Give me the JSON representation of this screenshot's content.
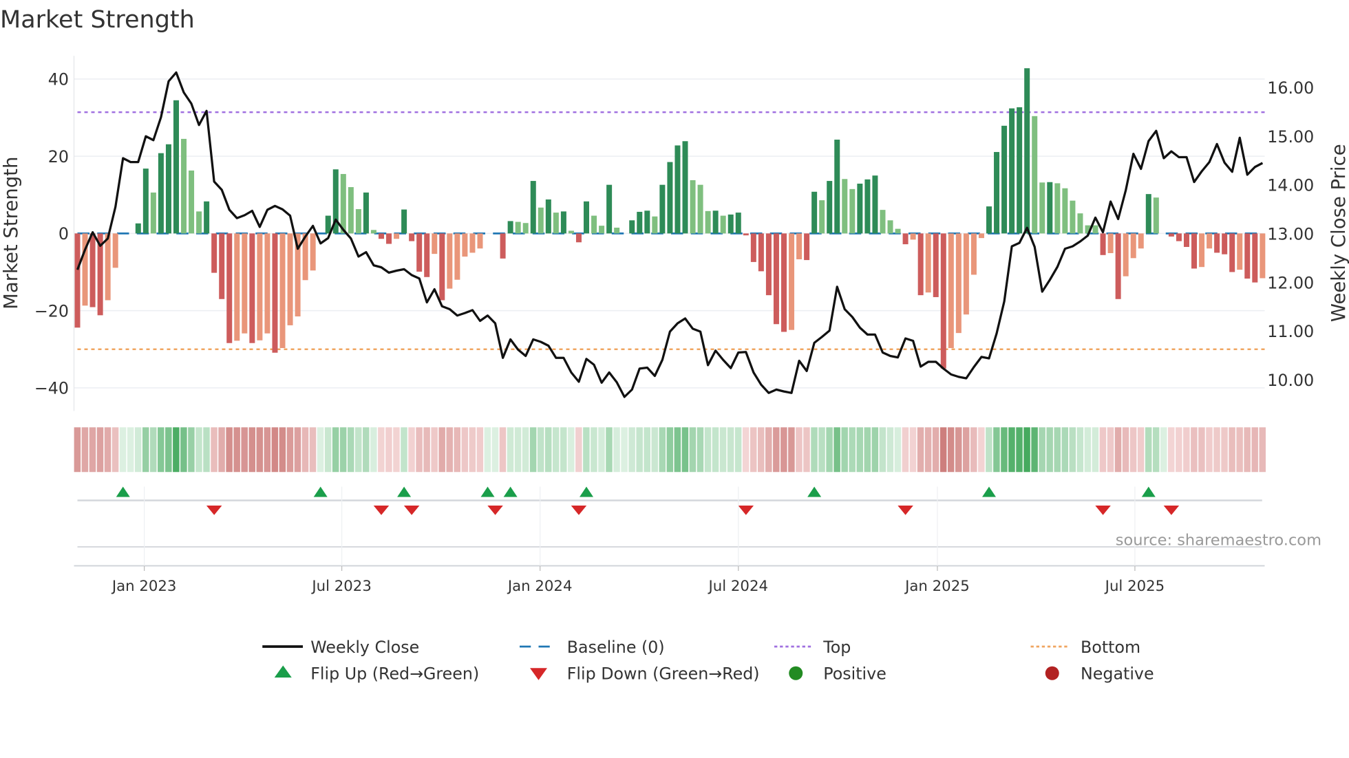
{
  "chart_data": {
    "type": "bar",
    "title": "Market Strength",
    "ylabel": "Market Strength",
    "ylabel_right": "Weekly Close Price",
    "ylim": [
      -46,
      46
    ],
    "ylim_right": [
      9.36,
      16.65
    ],
    "yticks": [
      40,
      20,
      0,
      -20,
      -40
    ],
    "yticks_right": [
      "16.00",
      "15.00",
      "14.00",
      "13.00",
      "12.00",
      "11.00",
      "10.00"
    ],
    "grid": true,
    "top_level": 31.4,
    "bottom_level": -30,
    "baseline": 0,
    "x_unit": "week index (1 = first week shown, ~early Nov 2022)",
    "x_ticks": [
      {
        "label": "Jan 2023",
        "week": 9.8
      },
      {
        "label": "Jul 2023",
        "week": 35.8
      },
      {
        "label": "Jan 2024",
        "week": 61.9
      },
      {
        "label": "Jul 2024",
        "week": 88.0
      },
      {
        "label": "Jan 2025",
        "week": 114.2
      },
      {
        "label": "Jul 2025",
        "week": 140.2
      }
    ],
    "strength": [
      -24.4,
      -18.7,
      -19.1,
      -21.2,
      -17.3,
      -8.9,
      0,
      0,
      2.6,
      16.8,
      10.6,
      20.8,
      23.1,
      34.5,
      24.5,
      16.3,
      5.7,
      8.3,
      -10.2,
      -17,
      -28.4,
      -27.8,
      -25.9,
      -28.4,
      -27.7,
      -25.9,
      -30.9,
      -29.7,
      -23.8,
      -21.5,
      -12.1,
      -9.6,
      0,
      4.6,
      16.6,
      15.4,
      12,
      6.3,
      10.6,
      0.9,
      -1.4,
      -2.7,
      -1.4,
      6.2,
      -2,
      -9.9,
      -11.3,
      -5.3,
      -17.3,
      -14.3,
      -12,
      -6,
      -5,
      -3.9,
      0,
      0,
      -6.5,
      3.2,
      3,
      2.7,
      13.6,
      6.7,
      8.8,
      5.4,
      5.7,
      0.7,
      -2.3,
      8.3,
      4.6,
      2,
      12.6,
      1.5,
      0,
      3.4,
      5.6,
      5.9,
      4.4,
      12.6,
      18.5,
      22.8,
      23.9,
      13.8,
      12.6,
      5.8,
      5.9,
      4.6,
      4.9,
      5.4,
      -0.5,
      -7.4,
      -9.8,
      -16,
      -23.5,
      -25.5,
      -25,
      -6.7,
      -6.9,
      10.8,
      8.6,
      13.6,
      24.3,
      14.1,
      11.5,
      12.9,
      14,
      15,
      6.1,
      3.4,
      1.2,
      -2.8,
      -1.6,
      -16,
      -15.3,
      -16.5,
      -35,
      -29.7,
      -25.8,
      -21,
      -10.7,
      -1.2,
      7,
      21.1,
      27.9,
      32.4,
      32.7,
      42.8,
      30.4,
      13.2,
      13.3,
      13,
      11.7,
      8.5,
      5.2,
      2.1,
      2.1,
      -5.6,
      -5.1,
      -17,
      -11.1,
      -6.4,
      -3.9,
      10.2,
      9.3,
      0,
      -0.8,
      -2,
      -3.5,
      -9.1,
      -8.7,
      -3.9,
      -5,
      -5.4,
      -10,
      -9.4,
      -11.7,
      -12.7,
      -11.6
    ],
    "strength_strong": [
      1,
      0,
      1,
      1,
      0,
      0,
      0,
      0,
      1,
      1,
      0,
      1,
      1,
      1,
      0,
      0,
      0,
      1,
      1,
      1,
      1,
      0,
      0,
      1,
      0,
      0,
      1,
      0,
      0,
      0,
      0,
      0,
      0,
      1,
      1,
      0,
      0,
      0,
      1,
      0,
      1,
      1,
      0,
      1,
      1,
      1,
      1,
      0,
      1,
      0,
      0,
      0,
      0,
      0,
      0,
      0,
      1,
      1,
      0,
      0,
      1,
      0,
      1,
      0,
      1,
      0,
      1,
      1,
      0,
      0,
      1,
      0,
      0,
      1,
      1,
      1,
      0,
      1,
      1,
      1,
      1,
      0,
      0,
      0,
      1,
      0,
      1,
      1,
      1,
      1,
      1,
      1,
      1,
      1,
      0,
      0,
      1,
      1,
      0,
      1,
      1,
      0,
      0,
      1,
      1,
      1,
      0,
      0,
      0,
      1,
      0,
      1,
      0,
      1,
      1,
      0,
      0,
      0,
      0,
      0,
      1,
      1,
      1,
      1,
      1,
      1,
      0,
      0,
      1,
      0,
      0,
      0,
      0,
      0,
      0,
      1,
      0,
      1,
      0,
      0,
      0,
      1,
      0,
      0,
      1,
      1,
      1,
      1,
      0,
      0,
      1,
      1,
      1,
      0,
      1,
      1,
      0
    ],
    "close": [
      12.26,
      12.67,
      13.03,
      12.75,
      12.9,
      13.55,
      14.55,
      14.47,
      14.47,
      15.0,
      14.92,
      15.39,
      16.13,
      16.31,
      15.9,
      15.67,
      15.23,
      15.52,
      14.07,
      13.9,
      13.49,
      13.32,
      13.38,
      13.47,
      13.14,
      13.49,
      13.57,
      13.5,
      13.37,
      12.69,
      12.94,
      13.16,
      12.8,
      12.91,
      13.29,
      13.08,
      12.9,
      12.53,
      12.62,
      12.35,
      12.31,
      12.2,
      12.24,
      12.27,
      12.15,
      12.08,
      11.59,
      11.86,
      11.51,
      11.45,
      11.32,
      11.37,
      11.43,
      11.21,
      11.32,
      11.16,
      10.45,
      10.83,
      10.62,
      10.49,
      10.83,
      10.78,
      10.7,
      10.45,
      10.45,
      10.15,
      9.96,
      10.43,
      10.31,
      9.94,
      10.15,
      9.95,
      9.65,
      9.8,
      10.23,
      10.25,
      10.08,
      10.41,
      10.99,
      11.16,
      11.26,
      11.05,
      10.99,
      10.3,
      10.6,
      10.41,
      10.24,
      10.56,
      10.57,
      10.15,
      9.9,
      9.73,
      9.8,
      9.76,
      9.73,
      10.39,
      10.18,
      10.76,
      10.88,
      11.01,
      11.91,
      11.45,
      11.29,
      11.07,
      10.93,
      10.93,
      10.56,
      10.49,
      10.46,
      10.85,
      10.8,
      10.27,
      10.37,
      10.37,
      10.23,
      10.11,
      10.06,
      10.03,
      10.26,
      10.47,
      10.44,
      10.95,
      11.61,
      12.74,
      12.81,
      13.12,
      12.73,
      11.81,
      12.05,
      12.32,
      12.69,
      12.74,
      12.84,
      12.96,
      13.33,
      13.03,
      13.66,
      13.3,
      13.89,
      14.64,
      14.33,
      14.9,
      15.11,
      14.55,
      14.69,
      14.57,
      14.57,
      14.06,
      14.28,
      14.47,
      14.84,
      14.46,
      14.27,
      14.97,
      14.21,
      14.37,
      14.45
    ],
    "flips_up": [
      7,
      33,
      44,
      55,
      58,
      68,
      98,
      121,
      142
    ],
    "flips_down": [
      19,
      41,
      45,
      56,
      67,
      89,
      110,
      136,
      145
    ],
    "legend": [
      {
        "label": "Weekly Close",
        "symbol": "solid-line",
        "color": "#111111"
      },
      {
        "label": "Baseline (0)",
        "symbol": "dashed-line",
        "color": "#1f77b4"
      },
      {
        "label": "Top",
        "symbol": "dotted-line",
        "color": "#a070e0"
      },
      {
        "label": "Bottom",
        "symbol": "dotted-line",
        "color": "#f0a560"
      },
      {
        "label": "Flip Up (Red→Green)",
        "symbol": "triangle-up",
        "color": "#1a9e4a"
      },
      {
        "label": "Flip Down (Green→Red)",
        "symbol": "triangle-down",
        "color": "#d62728"
      },
      {
        "label": "Positive",
        "symbol": "circle",
        "color": "#228b22"
      },
      {
        "label": "Negative",
        "symbol": "circle",
        "color": "#b22222"
      }
    ],
    "legend_placement": "bottom",
    "source": "source: sharemaestro.com",
    "colors": {
      "pos_strong": "#2e8b57",
      "pos_weak": "#7fbf7f",
      "neg_strong": "#cd5c5c",
      "neg_weak": "#e9967a"
    }
  }
}
